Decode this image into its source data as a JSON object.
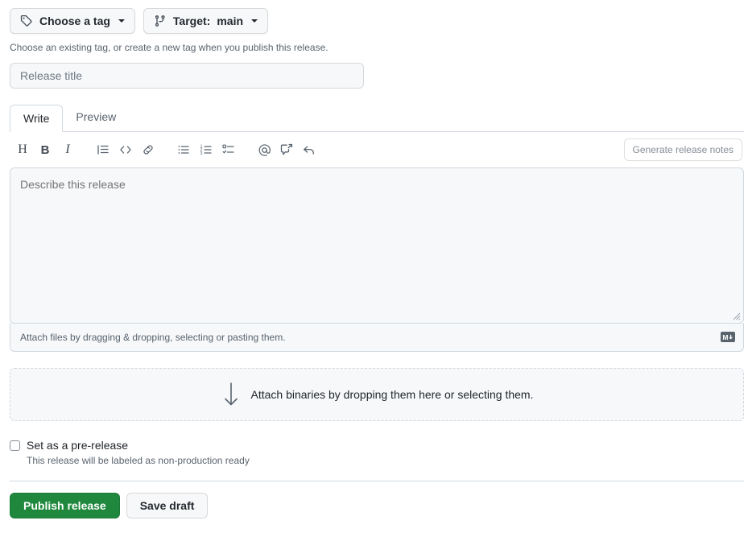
{
  "top": {
    "tag_button": {
      "label": "Choose a tag",
      "icon": "tag-icon"
    },
    "target_button": {
      "label": "Target:",
      "value": "main",
      "icon": "git-branch-icon"
    },
    "helper": "Choose an existing tag, or create a new tag when you publish this release."
  },
  "title_field": {
    "placeholder": "Release title",
    "value": ""
  },
  "editor": {
    "tabs": [
      {
        "label": "Write",
        "active": true
      },
      {
        "label": "Preview",
        "active": false
      }
    ],
    "toolbar": [
      {
        "name": "heading-icon",
        "glyph": "H"
      },
      {
        "name": "bold-icon",
        "glyph": "B"
      },
      {
        "name": "italic-icon",
        "glyph": "I"
      },
      {
        "name": "quote-icon",
        "glyph": ""
      },
      {
        "name": "code-icon",
        "glyph": "<>"
      },
      {
        "name": "link-icon",
        "glyph": ""
      },
      {
        "name": "unordered-list-icon",
        "glyph": ""
      },
      {
        "name": "ordered-list-icon",
        "glyph": ""
      },
      {
        "name": "task-list-icon",
        "glyph": ""
      },
      {
        "name": "mention-icon",
        "glyph": "@"
      },
      {
        "name": "cross-reference-icon",
        "glyph": ""
      },
      {
        "name": "reply-icon",
        "glyph": ""
      }
    ],
    "generate_notes_label": "Generate release notes",
    "body_placeholder": "Describe this release",
    "body_value": "",
    "attach_text": "Attach files by dragging & dropping, selecting or pasting them.",
    "markdown_badge": "M↓"
  },
  "dropzone": {
    "text": "Attach binaries by dropping them here or selecting them.",
    "icon": "download-arrow-icon"
  },
  "prerelease": {
    "label": "Set as a pre-release",
    "description": "This release will be labeled as non-production ready",
    "checked": false
  },
  "footer": {
    "publish_label": "Publish release",
    "draft_label": "Save draft"
  },
  "colors": {
    "primary_green": "#1f883d",
    "border": "#d1d9e0",
    "muted_text": "#59636e",
    "surface": "#f6f8fa"
  }
}
